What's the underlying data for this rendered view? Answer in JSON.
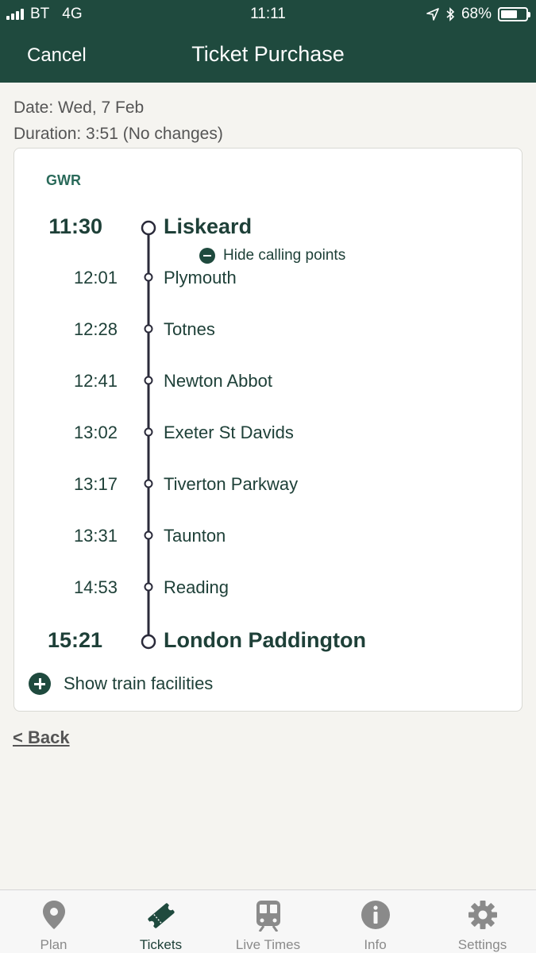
{
  "status_bar": {
    "carrier": "BT",
    "network": "4G",
    "time": "11:11",
    "battery": "68%",
    "battery_level": 0.68
  },
  "nav": {
    "cancel_label": "Cancel",
    "title": "Ticket Purchase"
  },
  "journey": {
    "date_label": "Date: Wed, 7 Feb",
    "duration_label": "Duration: 3:51 (No changes)",
    "operator": "GWR",
    "hide_calling_points_label": "Hide calling points",
    "facilities_label": "Show train facilities",
    "stops": [
      {
        "time": "11:30",
        "name": "Liskeard",
        "type": "main"
      },
      {
        "time": "12:01",
        "name": "Plymouth",
        "type": "call"
      },
      {
        "time": "12:28",
        "name": "Totnes",
        "type": "call"
      },
      {
        "time": "12:41",
        "name": "Newton Abbot",
        "type": "call"
      },
      {
        "time": "13:02",
        "name": "Exeter St Davids",
        "type": "call"
      },
      {
        "time": "13:17",
        "name": "Tiverton Parkway",
        "type": "call"
      },
      {
        "time": "13:31",
        "name": "Taunton",
        "type": "call"
      },
      {
        "time": "14:53",
        "name": "Reading",
        "type": "call"
      },
      {
        "time": "15:21",
        "name": "London Paddington",
        "type": "main"
      }
    ]
  },
  "back_label": "< Back",
  "colors": {
    "brand": "#1f4a3e",
    "accent_text": "#1e4038",
    "tab_inactive": "#8a8a8a"
  },
  "tabs": [
    {
      "label": "Plan",
      "icon": "location-pin-icon"
    },
    {
      "label": "Tickets",
      "icon": "ticket-icon",
      "active": true
    },
    {
      "label": "Live Times",
      "icon": "train-icon"
    },
    {
      "label": "Info",
      "icon": "info-icon"
    },
    {
      "label": "Settings",
      "icon": "gear-icon"
    }
  ]
}
